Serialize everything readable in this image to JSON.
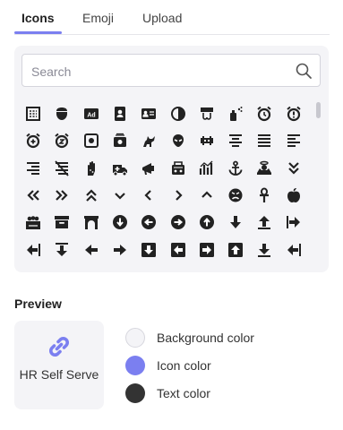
{
  "tabs": [
    {
      "label": "Icons",
      "active": true
    },
    {
      "label": "Emoji",
      "active": false
    },
    {
      "label": "Upload",
      "active": false
    }
  ],
  "search": {
    "placeholder": "Search",
    "value": ""
  },
  "icon_grid": {
    "icons": [
      "abacus-icon",
      "acorn-icon",
      "ad-icon",
      "address-book-icon",
      "address-card-icon",
      "adjust-icon",
      "air-freshener-icon",
      "aerosol-icon",
      "alarm-clock-icon",
      "alarm-exclamation-icon",
      "alarm-plus-icon",
      "alarm-snooze-icon",
      "album-icon",
      "album-collection-icon",
      "alicorn-icon",
      "alien-icon",
      "alien-monster-icon",
      "align-center-icon",
      "align-justify-icon",
      "align-left-icon",
      "align-right-icon",
      "align-slash-icon",
      "allergies-icon",
      "ambulance-icon",
      "megaphone-icon",
      "amp-guitar-icon",
      "analytics-icon",
      "anchor-icon",
      "angel-icon",
      "angle-double-down-icon",
      "angle-double-left-icon",
      "angle-double-right-icon",
      "angle-double-up-icon",
      "angle-down-icon",
      "angle-left-icon",
      "angle-right-icon",
      "angle-up-icon",
      "angry-icon",
      "ankh-icon",
      "apple-alt-icon",
      "apple-crate-icon",
      "archive-icon",
      "archway-icon",
      "arrow-alt-circle-down-icon",
      "arrow-alt-circle-left-icon",
      "arrow-alt-circle-right-icon",
      "arrow-alt-circle-up-icon",
      "arrow-alt-down-icon",
      "arrow-alt-from-bottom-icon",
      "arrow-alt-from-left-icon",
      "arrow-alt-from-right-icon",
      "arrow-alt-from-top-icon",
      "arrow-alt-left-icon",
      "arrow-alt-right-icon",
      "arrow-alt-square-down-icon",
      "arrow-alt-square-left-icon",
      "arrow-alt-square-right-icon",
      "arrow-alt-square-up-icon",
      "arrow-alt-to-bottom-icon",
      "arrow-alt-to-left-icon"
    ]
  },
  "preview": {
    "title": "Preview",
    "icon": "link-icon",
    "name": "HR Self Serve",
    "colors": [
      {
        "label": "Background color",
        "value": "#f4f4f7"
      },
      {
        "label": "Icon color",
        "value": "#7b7ff0"
      },
      {
        "label": "Text color",
        "value": "#333333"
      }
    ]
  }
}
